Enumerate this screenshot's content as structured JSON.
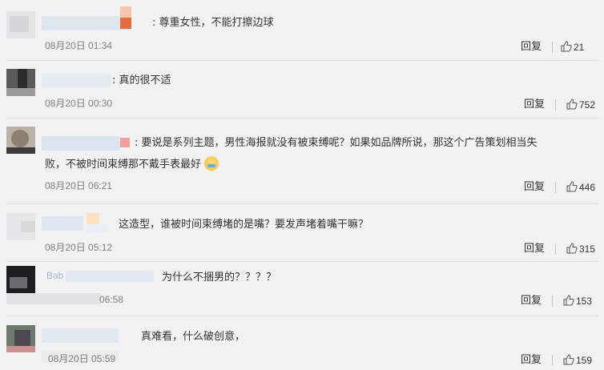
{
  "comments": [
    {
      "text": "尊重女性，不能打擦边球",
      "prefix": ": ",
      "time": "08月20日 01:34",
      "reply": "回复",
      "likes": "21"
    },
    {
      "text": "真的很不适",
      "prefix": ": ",
      "time": "08月20日 00:30",
      "reply": "回复",
      "likes": "752"
    },
    {
      "text_line1": "要说是系列主题，男性海报就没有被束缚呢？如果如品牌所说，那这个广告策划相当失",
      "text_line2": "败，不被时间束缚那不戴手表最好",
      "prefix": ": ",
      "time": "08月20日 06:21",
      "reply": "回复",
      "likes": "446"
    },
    {
      "text": "这造型，谁被时间束缚堵的是嘴？要发声堵着嘴干嘛？",
      "time": "08月20日 05:12",
      "reply": "回复",
      "likes": "315"
    },
    {
      "name_fragment": "Bab",
      "text": "为什么不捆男的？？？？",
      "time": "06:58",
      "reply": "回复",
      "likes": "153"
    },
    {
      "text": "真难看，什么破创意，",
      "time": "08月20日 05:59",
      "reply": "回复",
      "likes": "159"
    }
  ],
  "icons": {
    "like": "thumbs-up-icon",
    "emoji": "hug-emoji-icon"
  }
}
